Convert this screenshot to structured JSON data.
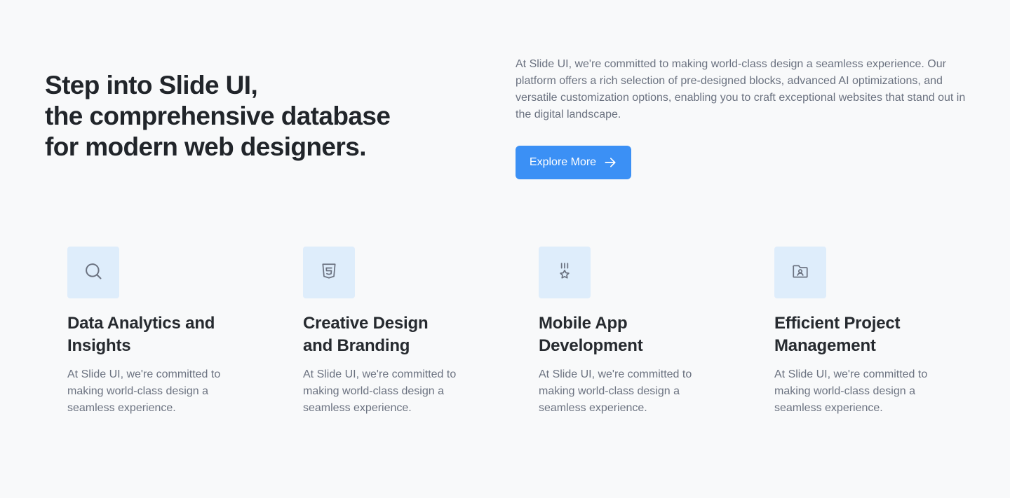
{
  "hero": {
    "title_lines": [
      "Step into Slide UI,",
      "the comprehensive database",
      "for modern web designers."
    ],
    "description": "At Slide UI, we're committed to making world-class design a seamless experience. Our platform offers a rich selection of pre-designed blocks, advanced AI optimizations, and versatile customization options, enabling you to craft exceptional websites that stand out in the digital landscape.",
    "cta_label": "Explore More",
    "cta_icon": "arrow-right-icon"
  },
  "features": [
    {
      "icon": "search-icon",
      "title_lines": [
        "Data Analytics and",
        "Insights"
      ],
      "desc_lines": [
        "At Slide UI, we're committed to",
        "making world-class design a",
        "seamless experience."
      ]
    },
    {
      "icon": "html5-icon",
      "title_lines": [
        "Creative Design",
        "and Branding"
      ],
      "desc_lines": [
        "At Slide UI, we're committed to",
        "making world-class design a",
        "seamless experience."
      ]
    },
    {
      "icon": "medal-icon",
      "title_lines": [
        "Mobile App",
        "Development"
      ],
      "desc_lines": [
        "At Slide UI, we're committed to",
        "making world-class design a",
        "seamless experience."
      ]
    },
    {
      "icon": "user-folder-icon",
      "title_lines": [
        "Efficient Project",
        "Management"
      ],
      "desc_lines": [
        "At Slide UI, we're committed to",
        "making world-class design a",
        "seamless experience."
      ]
    }
  ],
  "colors": {
    "background": "#f8f9fa",
    "accent": "#3b90f5",
    "icon_tile": "#deedfb",
    "heading": "#21252a",
    "body_text": "#6b7280",
    "icon_stroke": "#6b7280"
  }
}
